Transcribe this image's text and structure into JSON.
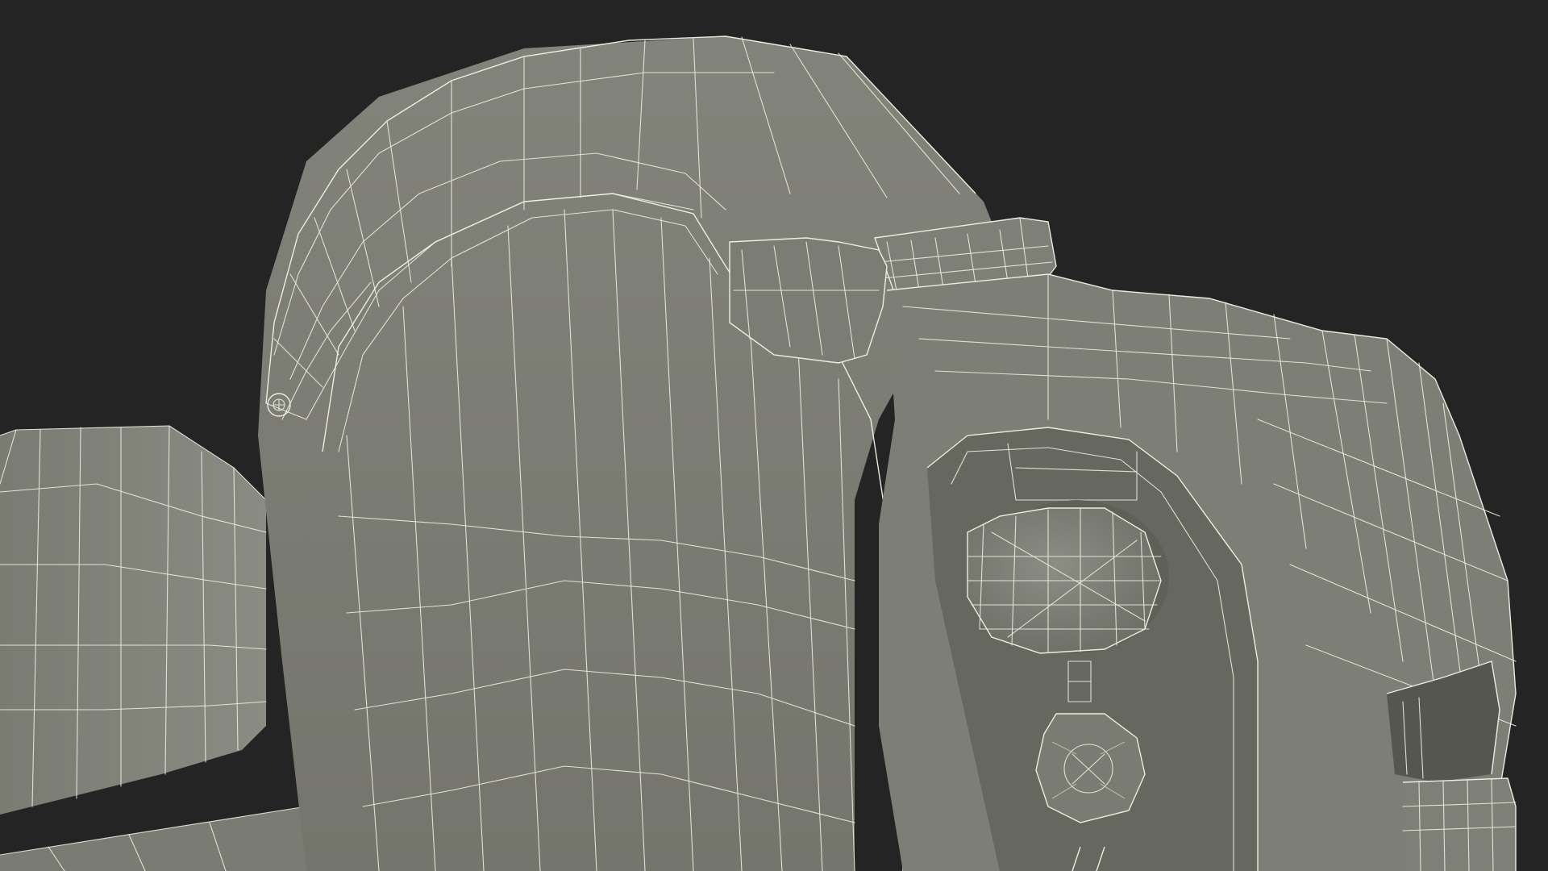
{
  "scene": {
    "background_color": "#242424",
    "model_color": "#7c7d74",
    "model_shadow_color": "#5e5f57",
    "wire_color": "#e9e9df"
  }
}
